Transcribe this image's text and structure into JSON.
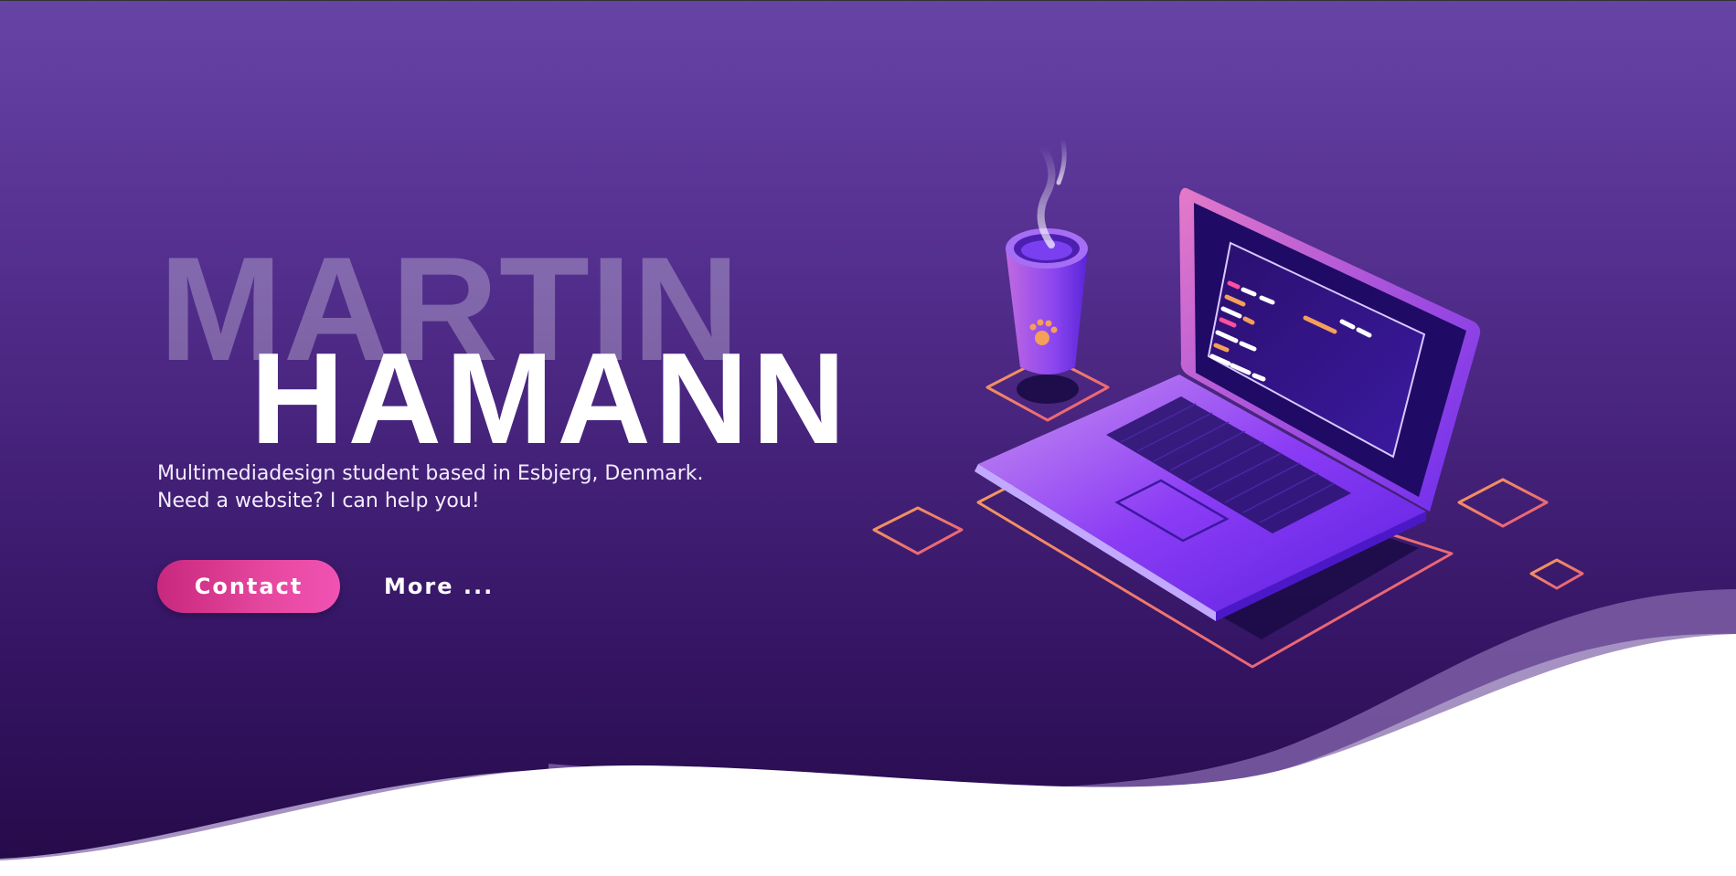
{
  "hero": {
    "first_name": "MARTIN",
    "last_name": "HAMANN",
    "tagline_line1": "Multimediadesign student based in Esbjerg, Denmark.",
    "tagline_line2": "Need a website? I can help you!",
    "contact_label": "Contact",
    "more_label": "More ..."
  },
  "colors": {
    "background_top": "#6644a6",
    "background_bottom": "#250a48",
    "contact_button": "#e6489f",
    "accent_orange": "#f08a5d"
  },
  "icons": {
    "illustration": "laptop-coffee-illustration"
  }
}
